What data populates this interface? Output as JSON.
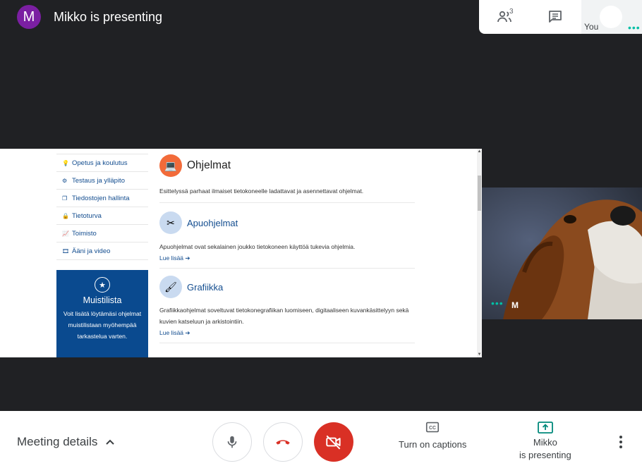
{
  "header": {
    "presenter_initial": "M",
    "title": "Mikko is presenting",
    "people_count": "3",
    "self_label": "You"
  },
  "screen": {
    "nav_items": [
      {
        "label": "Opetus ja koulutus",
        "icon": "lightbulb-icon"
      },
      {
        "label": "Testaus ja ylläpito",
        "icon": "gear-icon"
      },
      {
        "label": "Tiedostojen hallinta",
        "icon": "files-icon"
      },
      {
        "label": "Tietoturva",
        "icon": "lock-icon"
      },
      {
        "label": "Toimisto",
        "icon": "chart-icon"
      },
      {
        "label": "Ääni ja video",
        "icon": "film-icon"
      }
    ],
    "promo": {
      "title": "Muistilista",
      "text": "Voit lisätä löytämäsi ohjelmat muistilistaan myöhempää tarkastelua varten."
    },
    "articles": [
      {
        "title": "Ohjelmat",
        "desc": "Esittelyssä parhaat ilmaiset tietokoneelle ladattavat ja asennettavat ohjelmat.",
        "more": "",
        "icon": "computer-icon",
        "color": "#f26b3a"
      },
      {
        "title": "Apuohjelmat",
        "desc": "Apuohjelmat ovat sekalainen joukko tietokoneen käyttöä tukevia ohjelmia.",
        "more": "Lue lisää",
        "icon": "scissors-icon",
        "color": "#c9daf0"
      },
      {
        "title": "Grafiikka",
        "desc": "Grafiikkaohjelmat soveltuvat tietokonegrafiikan luomiseen, digitaaliseen kuvankäsittelyyn sekä kuvien katseluun ja arkistointiin.",
        "more": "Lue lisää",
        "icon": "brush-icon",
        "color": "#c9daf0"
      }
    ]
  },
  "thumbnail": {
    "name": "M"
  },
  "footer": {
    "meeting_details": "Meeting details",
    "captions_label": "Turn on captions",
    "presenting_line1": "Mikko",
    "presenting_line2": "is presenting"
  },
  "colors": {
    "avatar": "#7b1fa2",
    "accent": "#00bfa5",
    "end_call": "#d93025",
    "site_blue": "#0a4a8f"
  }
}
